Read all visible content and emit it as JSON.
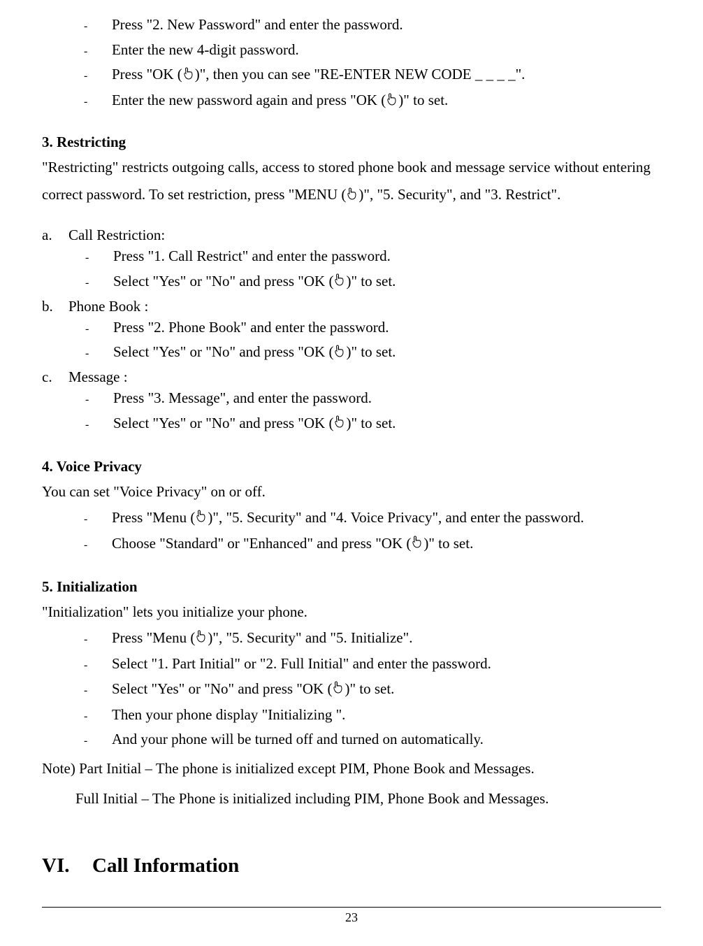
{
  "intro_items": [
    "Press \"2. New Password\" and enter the password.",
    "Enter the new 4-digit password.",
    "Press \"OK (__ICON__)\", then you can see \"RE-ENTER NEW CODE    _ _ _ _\".",
    "Enter the new password again and press \"OK (__ICON__)\" to set."
  ],
  "s3": {
    "heading": "3. Restricting",
    "body": "\"Restricting\" restricts outgoing calls, access to stored phone book and message service without entering correct password. To set restriction, press \"MENU (__ICON__)\", \"5. Security\", and \"3. Restrict\".",
    "items": [
      {
        "marker": "a.",
        "label": "Call Restriction:",
        "subs": [
          "Press \"1. Call Restrict\" and enter the password.",
          "Select \"Yes\" or \"No\" and press \"OK (__ICON__)\" to set."
        ]
      },
      {
        "marker": "b.",
        "label": "Phone Book :",
        "subs": [
          "Press \"2. Phone Book\" and enter the password.",
          "Select \"Yes\" or \"No\" and press \"OK (__ICON__)\" to set."
        ]
      },
      {
        "marker": "c.",
        "label": "Message :",
        "subs": [
          "Press \"3. Message\", and enter the password.",
          "Select \"Yes\" or \"No\" and press \"OK (__ICON__)\" to set."
        ]
      }
    ]
  },
  "s4": {
    "heading": "4. Voice Privacy",
    "body": "You can set \"Voice Privacy\" on or off.",
    "subs": [
      "Press \"Menu (__ICON__)\", \"5. Security\" and \"4. Voice Privacy\", and enter the password.",
      "Choose \"Standard\" or \"Enhanced\" and press \"OK (__ICON__)\" to set."
    ]
  },
  "s5": {
    "heading": "5. Initialization",
    "body": "\"Initialization\" lets you initialize your phone.",
    "subs": [
      "Press \"Menu (__ICON__)\", \"5. Security\" and \"5. Initialize\".",
      "Select \"1. Part Initial\" or \"2. Full Initial\" and enter the password.",
      "Select \"Yes\" or \"No\" and press \"OK (__ICON__)\" to set.",
      "Then your phone display \"Initializing \".",
      "And your phone will be turned off and turned on automatically."
    ],
    "note1": "Note) Part Initial – The phone is initialized except PIM, Phone Book and Messages.",
    "note2": "Full Initial – The Phone is initialized including PIM, Phone Book and Messages."
  },
  "h1": {
    "num": "VI.",
    "title": "Call Information"
  },
  "page_number": "23"
}
